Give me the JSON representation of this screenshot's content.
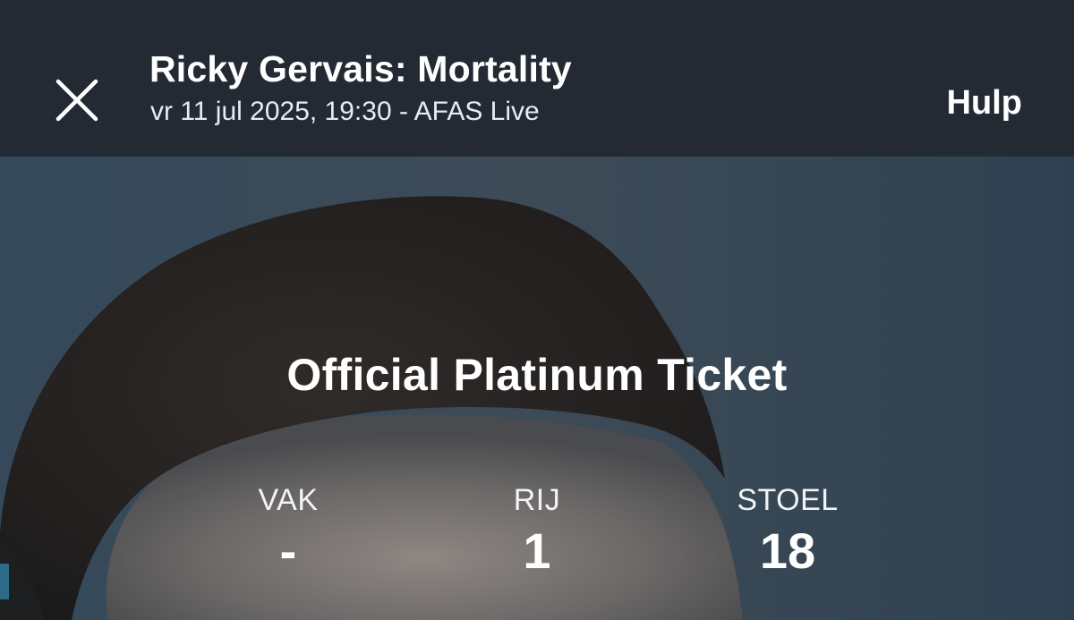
{
  "header": {
    "close_icon": "close-icon",
    "title": "Ricky Gervais: Mortality",
    "subtitle": "vr 11 jul 2025, 19:30 - AFAS Live",
    "help_label": "Hulp",
    "background_color": "#232a33"
  },
  "ticket": {
    "type": "Official Platinum Ticket",
    "seat_info": [
      {
        "label": "VAK",
        "value": "-"
      },
      {
        "label": "RIJ",
        "value": "1"
      },
      {
        "label": "STOEL",
        "value": "18"
      }
    ]
  }
}
